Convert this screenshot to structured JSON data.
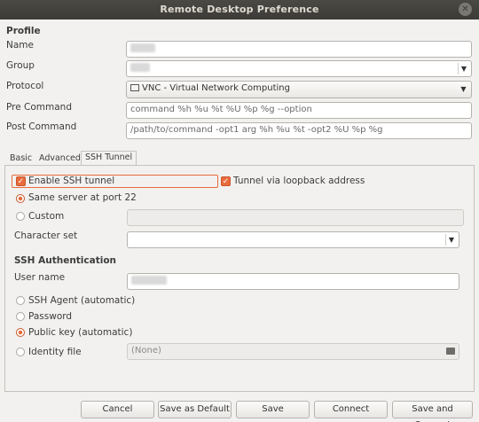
{
  "window": {
    "title": "Remote Desktop Preference"
  },
  "profile": {
    "section_label": "Profile",
    "name_label": "Name",
    "group_label": "Group",
    "protocol_label": "Protocol",
    "protocol_value": "VNC - Virtual Network Computing",
    "pre_command_label": "Pre Command",
    "pre_command_placeholder": "command %h %u %t %U %p %g --option",
    "post_command_label": "Post Command",
    "post_command_placeholder": "/path/to/command -opt1 arg %h %u %t -opt2 %U %p %g"
  },
  "tabs": [
    {
      "label": "Basic"
    },
    {
      "label": "Advanced"
    },
    {
      "label": "SSH Tunnel"
    }
  ],
  "ssh": {
    "enable_tunnel_label": "Enable SSH tunnel",
    "loopback_label": "Tunnel via loopback address",
    "same_server_label": "Same server at port 22",
    "custom_label": "Custom",
    "charset_label": "Character set",
    "auth_heading": "SSH Authentication",
    "username_label": "User name",
    "agent_label": "SSH Agent (automatic)",
    "password_label": "Password",
    "pubkey_label": "Public key (automatic)",
    "identity_label": "Identity file",
    "identity_value": "(None)"
  },
  "buttons": {
    "cancel": "Cancel",
    "save_default": "Save as Default",
    "save": "Save",
    "connect": "Connect",
    "save_connect": "Save and Connect"
  },
  "colors": {
    "accent": "#e96b3c",
    "titlebar": "#3c3b37"
  }
}
